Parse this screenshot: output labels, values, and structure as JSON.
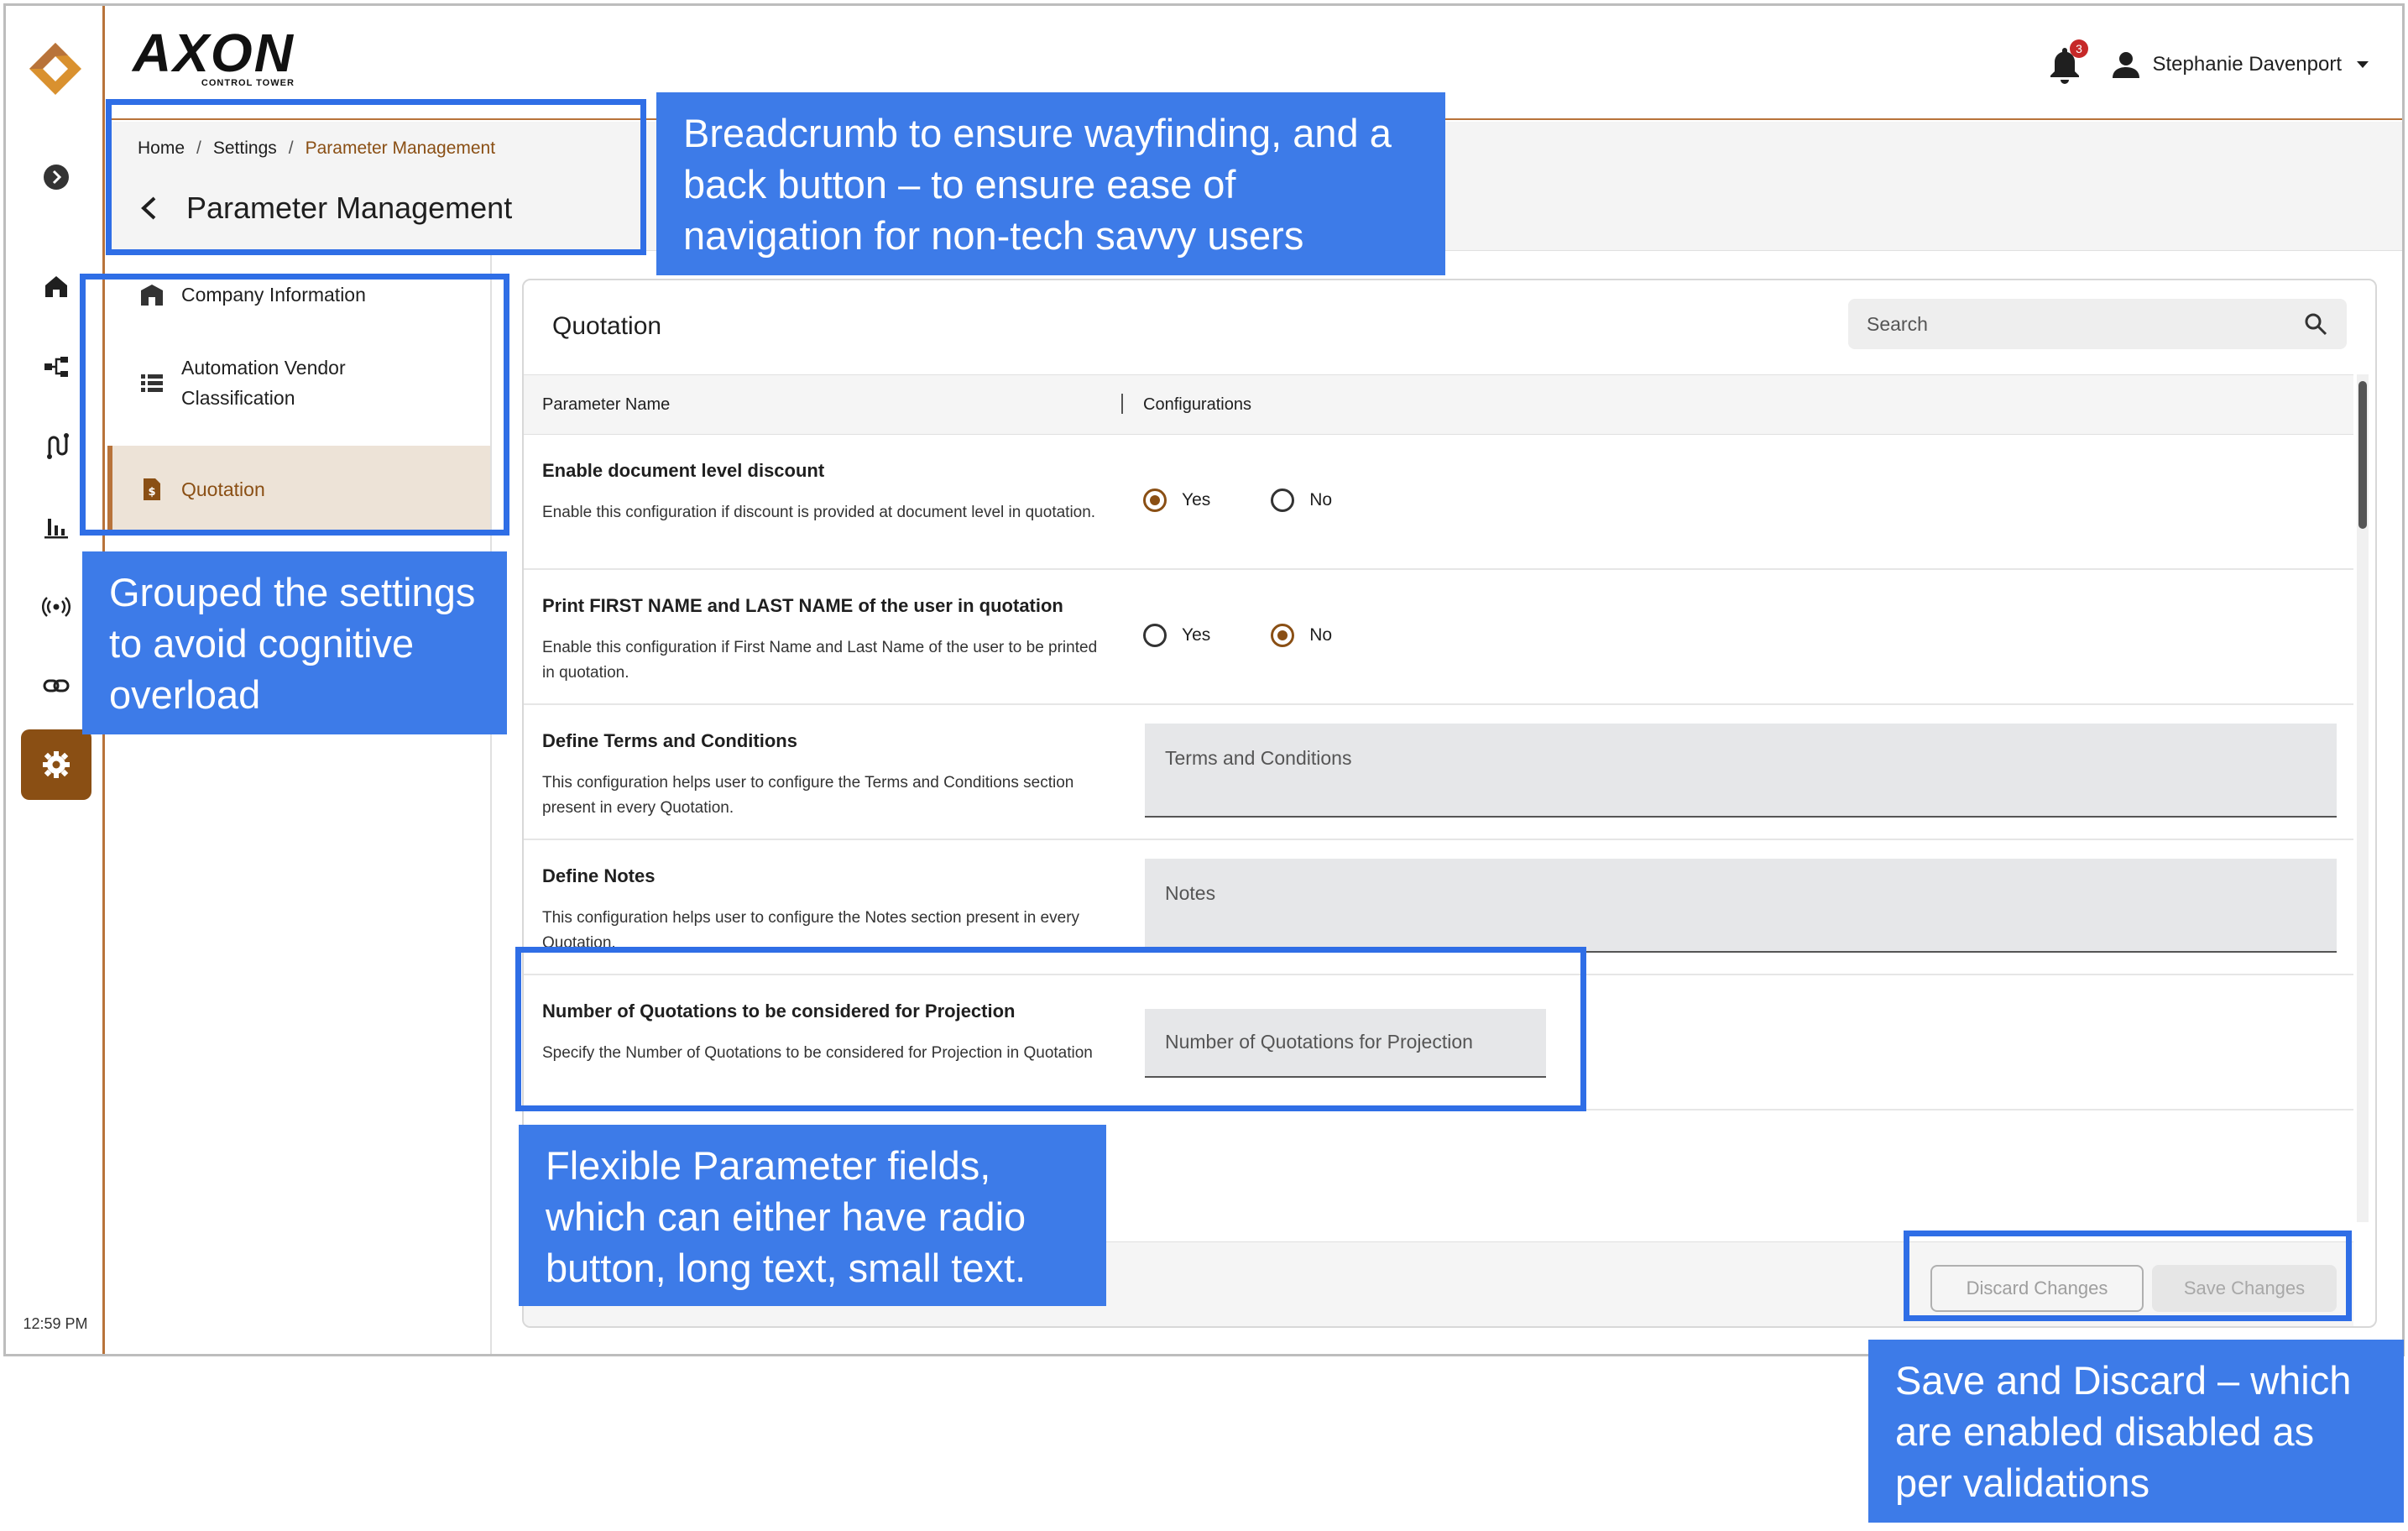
{
  "brand": {
    "name": "AXON",
    "tagline": "CONTROL TOWER"
  },
  "rail": {
    "time": "12:59 PM"
  },
  "header": {
    "notifications_count": "3",
    "user_name": "Stephanie Davenport"
  },
  "breadcrumb": {
    "home": "Home",
    "settings": "Settings",
    "current": "Parameter Management",
    "separator": "/"
  },
  "page_title": "Parameter Management",
  "settings_nav": {
    "items": [
      {
        "label": "Company Information"
      },
      {
        "label": "Automation Vendor Classification"
      },
      {
        "label": "Quotation"
      }
    ]
  },
  "panel": {
    "title": "Quotation",
    "search_placeholder": "Search",
    "columns": {
      "name": "Parameter Name",
      "config": "Configurations"
    },
    "rows": [
      {
        "name": "Enable document level discount",
        "desc": "Enable this configuration if discount is provided at document level in quotation.",
        "yes": "Yes",
        "no": "No",
        "selected": "Yes"
      },
      {
        "name": "Print FIRST NAME and LAST NAME of the user in quotation",
        "desc": "Enable this configuration if First Name and Last Name of the user to be printed in quotation.",
        "yes": "Yes",
        "no": "No",
        "selected": "No"
      },
      {
        "name": "Define Terms and Conditions",
        "desc": "This configuration helps user to configure the Terms and Conditions section present in every Quotation.",
        "placeholder": "Terms and Conditions"
      },
      {
        "name": "Define Notes",
        "desc": "This configuration helps user to configure the Notes section present in every Quotation.",
        "placeholder": "Notes"
      },
      {
        "name": "Number of Quotations to be considered for Projection",
        "desc": "Specify the Number of Quotations to be considered for Projection in Quotation",
        "placeholder": "Number of Quotations for Projection"
      }
    ],
    "discard_label": "Discard Changes",
    "save_label": "Save Changes"
  },
  "annotations": {
    "breadcrumb_note": "Breadcrumb to ensure wayfinding, and a back button – to ensure ease of navigation for non-tech savvy users",
    "grouping_note": "Grouped the settings to avoid cognitive overload",
    "fields_note": "Flexible Parameter fields, which can either have radio button, long text, small text.",
    "buttons_note": "Save and Discard – which are enabled disabled as per validations"
  },
  "colors": {
    "brand": "#8a4f14",
    "accent": "#b8733a",
    "annotation": "#3d7be8"
  }
}
